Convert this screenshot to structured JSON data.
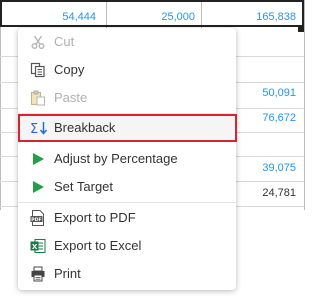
{
  "sheet": {
    "top_row": [
      "54,444",
      "25,000",
      "165,838"
    ],
    "side_values": [
      "50,091",
      "76,672",
      "39,075",
      "24,781"
    ]
  },
  "menu": {
    "items": [
      {
        "label": "Cut",
        "icon": "scissors-icon",
        "disabled": true
      },
      {
        "label": "Copy",
        "icon": "copy-icon",
        "disabled": false
      },
      {
        "label": "Paste",
        "icon": "paste-icon",
        "disabled": true
      },
      {
        "label": "Breakback",
        "icon": "sigma-down-arrow-icon",
        "disabled": false,
        "highlighted": true
      },
      {
        "label": "Adjust by Percentage",
        "icon": "play-triangle-icon",
        "disabled": false
      },
      {
        "label": "Set Target",
        "icon": "play-triangle-icon",
        "disabled": false
      },
      {
        "label": "Export to PDF",
        "icon": "pdf-icon",
        "disabled": false
      },
      {
        "label": "Export to Excel",
        "icon": "excel-icon",
        "disabled": false
      },
      {
        "label": "Print",
        "icon": "printer-icon",
        "disabled": false
      }
    ]
  },
  "colors": {
    "accent_blue": "#2196f3",
    "green_arrow": "#21a047",
    "highlight_border": "#d6252e",
    "excel_green": "#1e7a45"
  }
}
